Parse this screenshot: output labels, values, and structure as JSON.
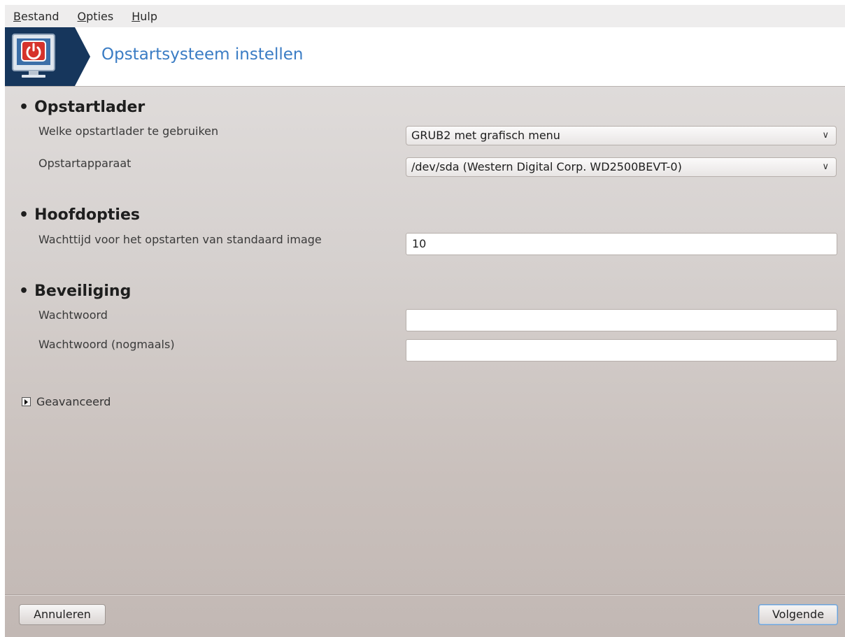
{
  "menubar": {
    "items": [
      {
        "mnemonic": "B",
        "rest": "estand"
      },
      {
        "mnemonic": "O",
        "rest": "pties"
      },
      {
        "mnemonic": "H",
        "rest": "ulp"
      }
    ]
  },
  "banner": {
    "title": "Opstartsysteem instellen",
    "icon": "power-monitor-icon"
  },
  "sections": {
    "bootloader": {
      "title": "Opstartlader",
      "which_label": "Welke opstartlader te gebruiken",
      "which_value": "GRUB2 met grafisch menu",
      "device_label": "Opstartapparaat",
      "device_value": "/dev/sda (Western Digital Corp. WD2500BEVT-0)"
    },
    "main_options": {
      "title": "Hoofdopties",
      "delay_label": "Wachttijd voor het opstarten van standaard image",
      "delay_value": "10"
    },
    "security": {
      "title": "Beveiliging",
      "password_label": "Wachtwoord",
      "password_value": "",
      "password_again_label": "Wachtwoord (nogmaals)",
      "password_again_value": ""
    }
  },
  "advanced": {
    "label": "Geavanceerd",
    "expanded": false
  },
  "buttons": {
    "cancel": "Annuleren",
    "next": "Volgende"
  },
  "colors": {
    "banner_title": "#3a7cc4",
    "logo_bg": "#16365c",
    "icon_red": "#d6332c"
  }
}
